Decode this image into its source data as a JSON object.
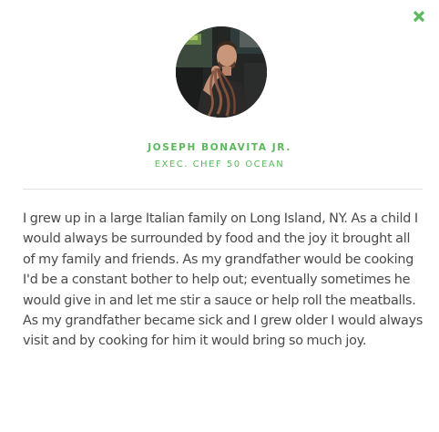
{
  "modal": {
    "close_icon": "close-icon",
    "accent_color": "#5cb85c",
    "profile": {
      "photo_icon": "chef-portrait",
      "name": "JOSEPH BONAVITA JR.",
      "title": "EXEC. CHEF 50 OCEAN"
    },
    "bio": "I grew up in a large Italian family on Long Island, NY. As a child I would always be surrounded by food and the joy it brought all of my family and friends. As my grandfather would be cooking I'd be a constant bother to help out; eventually sometimes he would give in and let me stir a sauce or help roll the meatballs. As my grandfather became sick and I grew older I would always visit and by cooking for him it would bring so much joy."
  }
}
